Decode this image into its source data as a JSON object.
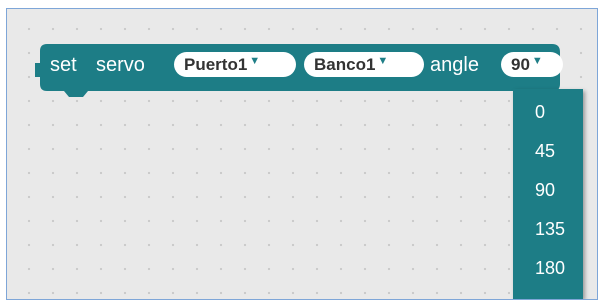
{
  "workspace": {
    "background_color": "#e9e9e9",
    "grid_dot_color": "#c9c9c9",
    "border_color": "#7ea6d8"
  },
  "block": {
    "color": "#1d7d86",
    "set_label": "set",
    "servo_label": "servo",
    "port_value": "Puerto1",
    "bank_value": "Banco1",
    "angle_label": "angle",
    "angle_value": "90",
    "dropdown_arrow": "▼"
  },
  "angle_dropdown": {
    "options": [
      "0",
      "45",
      "90",
      "135",
      "180"
    ]
  }
}
